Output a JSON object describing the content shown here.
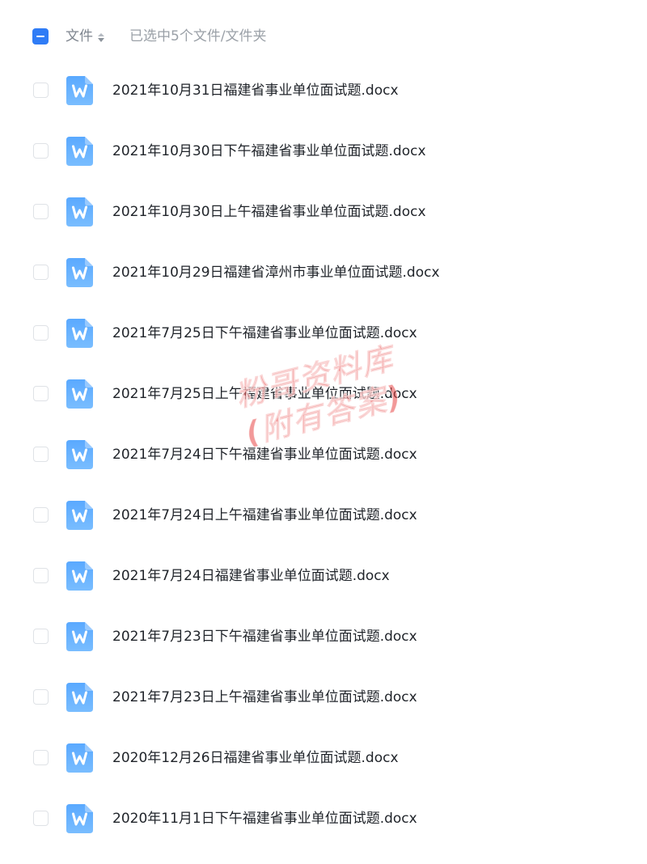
{
  "header": {
    "column_label": "文件",
    "selection_status": "已选中5个文件/文件夹"
  },
  "files": [
    {
      "name": "2021年10月31日福建省事业单位面试题.docx"
    },
    {
      "name": "2021年10月30日下午福建省事业单位面试题.docx"
    },
    {
      "name": "2021年10月30日上午福建省事业单位面试题.docx"
    },
    {
      "name": "2021年10月29日福建省漳州市事业单位面试题.docx"
    },
    {
      "name": "2021年7月25日下午福建省事业单位面试题.docx"
    },
    {
      "name": "2021年7月25日上午福建省事业单位面试题.docx"
    },
    {
      "name": "2021年7月24日下午福建省事业单位面试题.docx"
    },
    {
      "name": "2021年7月24日上午福建省事业单位面试题.docx"
    },
    {
      "name": "2021年7月24日福建省事业单位面试题.docx"
    },
    {
      "name": "2021年7月23日下午福建省事业单位面试题.docx"
    },
    {
      "name": "2021年7月23日上午福建省事业单位面试题.docx"
    },
    {
      "name": "2020年12月26日福建省事业单位面试题.docx"
    },
    {
      "name": "2020年11月1日下午福建省事业单位面试题.docx"
    }
  ],
  "watermark": {
    "line1": "粉哥资料库",
    "line2": "(附有答案)"
  },
  "colors": {
    "accent": "#2f7cf6",
    "doc_icon_top": "#5aa9ff",
    "doc_icon_bottom": "#79bdff",
    "watermark": "#e84646"
  },
  "icons": {
    "file_type": "word-document-icon",
    "sort": "sort-caret-icon",
    "select_all": "indeterminate-checkbox-icon"
  }
}
